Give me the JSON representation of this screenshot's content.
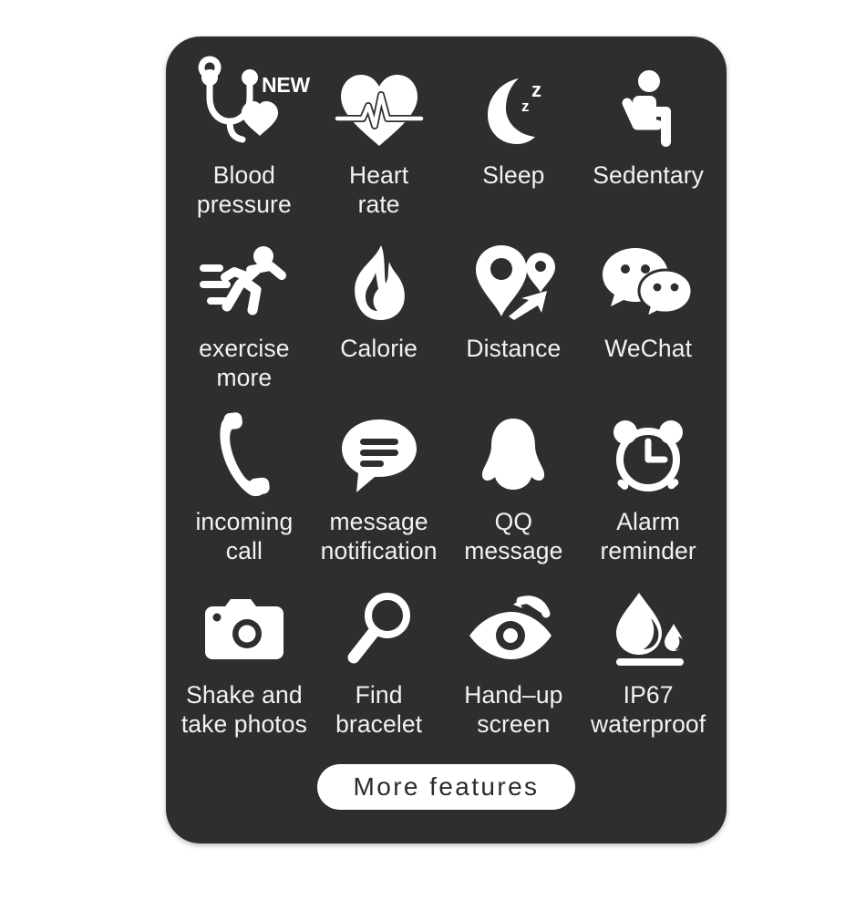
{
  "card": {
    "background_color": "#2e2e2e",
    "text_color": "#f2f2f2"
  },
  "features": [
    {
      "id": "blood-pressure",
      "icon": "stethoscope-heart-icon",
      "label": "Blood\npressure",
      "badge": "NEW"
    },
    {
      "id": "heart-rate",
      "icon": "heart-ecg-icon",
      "label": "Heart\nrate"
    },
    {
      "id": "sleep",
      "icon": "moon-zzz-icon",
      "label": "Sleep"
    },
    {
      "id": "sedentary",
      "icon": "seated-person-icon",
      "label": "Sedentary"
    },
    {
      "id": "exercise-more",
      "icon": "running-person-icon",
      "label": "exercise\nmore"
    },
    {
      "id": "calorie",
      "icon": "flame-icon",
      "label": "Calorie"
    },
    {
      "id": "distance",
      "icon": "map-pins-route-icon",
      "label": "Distance"
    },
    {
      "id": "wechat",
      "icon": "wechat-bubbles-icon",
      "label": "WeChat"
    },
    {
      "id": "incoming-call",
      "icon": "phone-handset-icon",
      "label": "incoming\ncall"
    },
    {
      "id": "message-notification",
      "icon": "speech-bubble-lines-icon",
      "label": "message\nnotification"
    },
    {
      "id": "qq-message",
      "icon": "qq-penguin-icon",
      "label": "QQ\nmessage"
    },
    {
      "id": "alarm-reminder",
      "icon": "alarm-clock-icon",
      "label": "Alarm\nreminder"
    },
    {
      "id": "shake-take-photos",
      "icon": "camera-icon",
      "label": "Shake and\ntake photos"
    },
    {
      "id": "find-bracelet",
      "icon": "magnifier-icon",
      "label": "Find\nbracelet"
    },
    {
      "id": "hand-up-screen",
      "icon": "eye-arrow-icon",
      "label": "Hand–up\nscreen"
    },
    {
      "id": "ip67-waterproof",
      "icon": "water-drop-icon",
      "label": "IP67\nwaterproof"
    }
  ],
  "more_features_button": {
    "label": "More features"
  }
}
